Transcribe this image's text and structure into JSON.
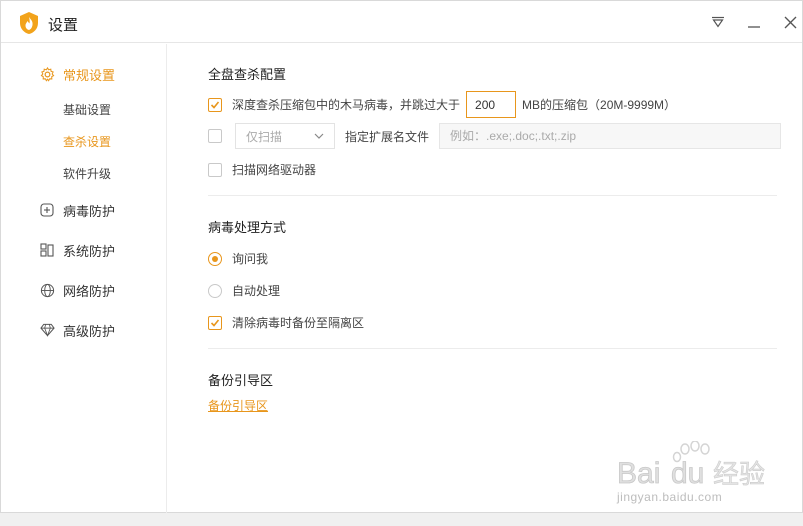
{
  "window": {
    "title": "设置"
  },
  "sidebar": {
    "items": [
      {
        "label": "常规设置",
        "icon": "gear-icon",
        "active": true
      },
      {
        "label": "病毒防护",
        "icon": "plus-square-icon",
        "active": false
      },
      {
        "label": "系统防护",
        "icon": "grid-icon",
        "active": false
      },
      {
        "label": "网络防护",
        "icon": "globe-icon",
        "active": false
      },
      {
        "label": "高级防护",
        "icon": "diamond-icon",
        "active": false
      }
    ],
    "sub_items": [
      {
        "label": "基础设置",
        "active": false
      },
      {
        "label": "查杀设置",
        "active": true
      },
      {
        "label": "软件升级",
        "active": false
      }
    ]
  },
  "scan_config": {
    "title": "全盘查杀配置",
    "deep_scan": {
      "checked": true,
      "label_before": "深度查杀压缩包中的木马病毒，并跳过大于",
      "size_value": "200",
      "label_after": "MB的压缩包（20M-9999M）"
    },
    "scan_mode": {
      "checked": false,
      "selected": "仅扫描",
      "ext_label": "指定扩展名文件",
      "ext_placeholder": "例如：.exe;.doc;.txt;.zip"
    },
    "network_drive": {
      "checked": false,
      "label": "扫描网络驱动器"
    }
  },
  "virus_handling": {
    "title": "病毒处理方式",
    "options": [
      {
        "label": "询问我",
        "checked": true
      },
      {
        "label": "自动处理",
        "checked": false
      }
    ],
    "backup": {
      "checked": true,
      "label": "清除病毒时备份至隔离区"
    }
  },
  "backup_guide": {
    "title": "备份引导区",
    "link": "备份引导区"
  },
  "watermark": {
    "text": "jingyan.baidu.com",
    "brand": "Bai经验"
  },
  "colors": {
    "accent": "#e8961c",
    "border": "#e6e6e6"
  }
}
